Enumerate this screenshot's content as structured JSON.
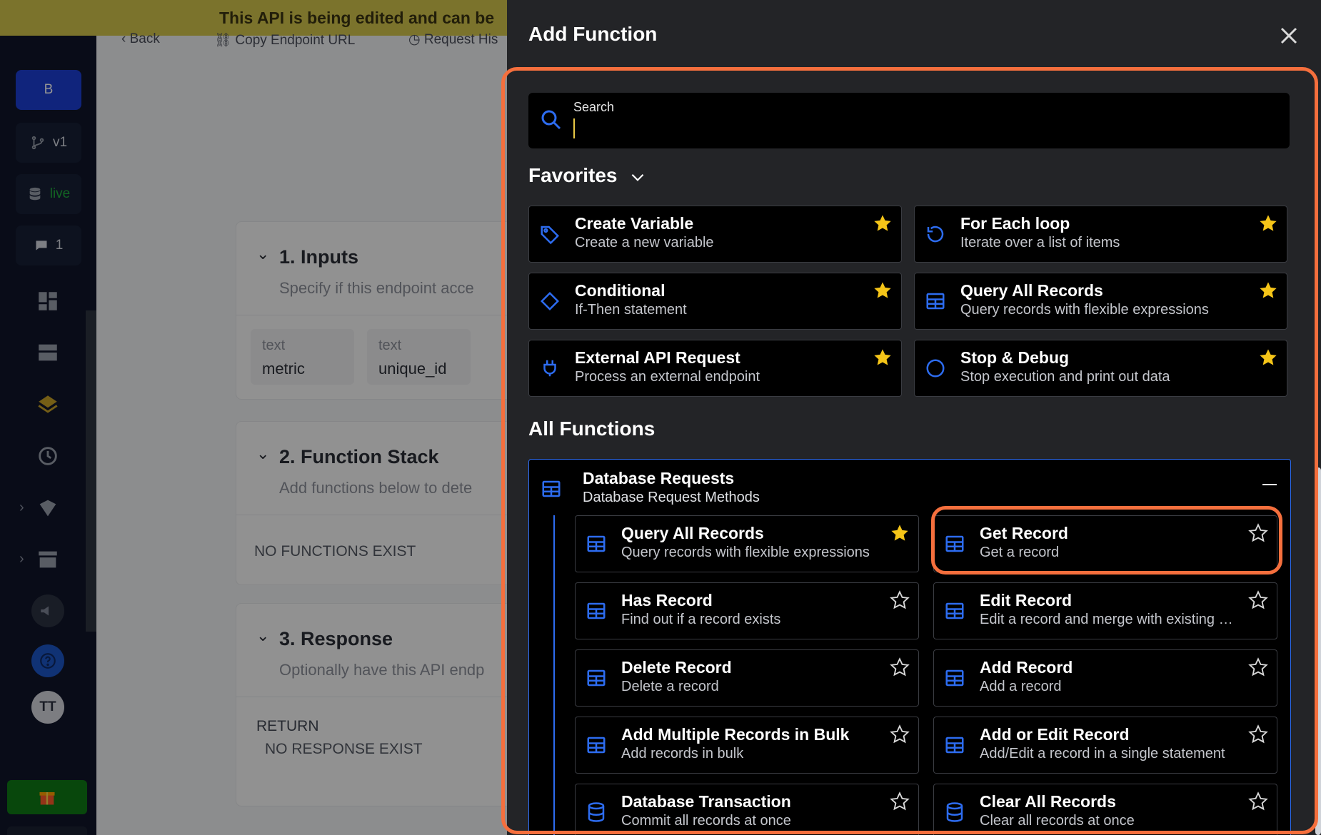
{
  "background": {
    "banner_text": "This API is being edited and can be",
    "topbar": {
      "back_label": "Back",
      "copy_url_label": "Copy Endpoint URL",
      "request_history_label": "Request His"
    },
    "leftbar": {
      "workspace_initial": "B",
      "branch_label": "v1",
      "datasource_label": "live",
      "comments_count": "1",
      "avatar_initials": "TT"
    },
    "sections": {
      "inputs": {
        "title": "1. Inputs",
        "subtitle": "Specify if this endpoint acce",
        "items": [
          {
            "type": "text",
            "name": "metric"
          },
          {
            "type": "text",
            "name": "unique_id"
          }
        ]
      },
      "function_stack": {
        "title": "2. Function Stack",
        "subtitle": "Add functions below to dete",
        "empty_text": "NO FUNCTIONS EXIST"
      },
      "response": {
        "title": "3. Response",
        "subtitle": "Optionally have this API endp",
        "return_label": "RETURN",
        "empty_text": "NO RESPONSE EXIST"
      }
    }
  },
  "drawer": {
    "title": "Add Function",
    "search": {
      "label": "Search",
      "value": ""
    },
    "favorites_heading": "Favorites",
    "favorites": [
      {
        "title": "Create Variable",
        "desc": "Create a new variable",
        "icon": "tag-icon"
      },
      {
        "title": "For Each loop",
        "desc": "Iterate over a list of items",
        "icon": "loop-icon"
      },
      {
        "title": "Conditional",
        "desc": "If-Then statement",
        "icon": "diamond-icon"
      },
      {
        "title": "Query All Records",
        "desc": "Query records with flexible expressions",
        "icon": "table-icon"
      },
      {
        "title": "External API Request",
        "desc": "Process an external endpoint",
        "icon": "plug-icon"
      },
      {
        "title": "Stop & Debug",
        "desc": "Stop execution and print out data",
        "icon": "circle-icon"
      }
    ],
    "all_functions_heading": "All Functions",
    "group": {
      "title": "Database Requests",
      "desc": "Database Request Methods",
      "items": [
        {
          "title": "Query All Records",
          "desc": "Query records with flexible expressions",
          "starred": true
        },
        {
          "title": "Get Record",
          "desc": "Get a record",
          "starred": false
        },
        {
          "title": "Has Record",
          "desc": "Find out if a record exists",
          "starred": false
        },
        {
          "title": "Edit Record",
          "desc": "Edit a record and merge with existing d...",
          "starred": false
        },
        {
          "title": "Delete Record",
          "desc": "Delete a record",
          "starred": false
        },
        {
          "title": "Add Record",
          "desc": "Add a record",
          "starred": false
        },
        {
          "title": "Add Multiple Records in Bulk",
          "desc": "Add records in bulk",
          "starred": false
        },
        {
          "title": "Add or Edit Record",
          "desc": "Add/Edit a record in a single statement",
          "starred": false
        },
        {
          "title": "Database Transaction",
          "desc": "Commit all records at once",
          "starred": false
        },
        {
          "title": "Clear All Records",
          "desc": "Clear all records at once",
          "starred": false
        }
      ]
    }
  },
  "colors": {
    "accent_blue": "#2d6cf0",
    "star_gold": "#f5c518",
    "highlight_orange": "#f56f3d",
    "banner_yellow": "#d5c64c"
  }
}
